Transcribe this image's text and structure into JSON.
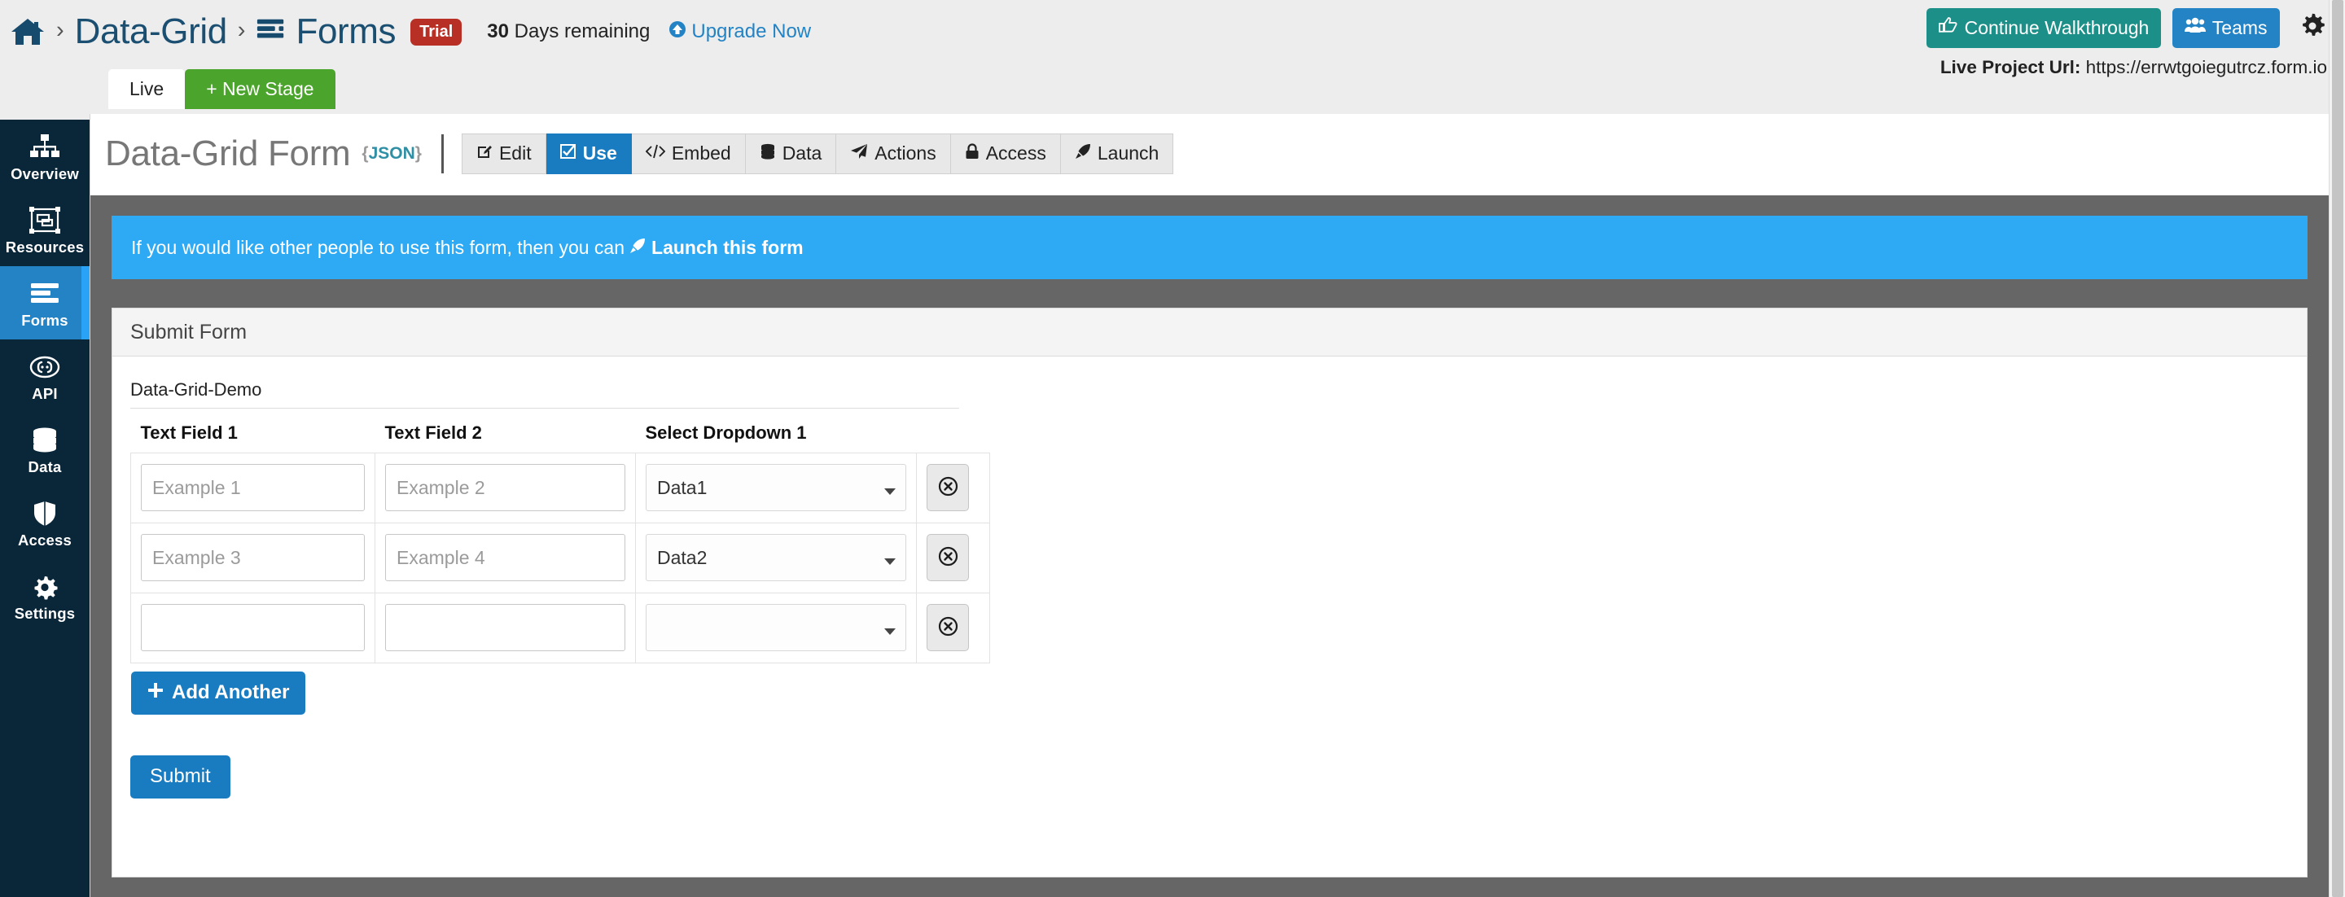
{
  "header": {
    "breadcrumb": {
      "home_icon": "home-icon",
      "separator": "›",
      "project": "Data-Grid",
      "section_icon": "forms-icon",
      "section": "Forms",
      "trial_badge": "Trial"
    },
    "trial_days": "30",
    "trial_text": "Days remaining",
    "upgrade_label": "Upgrade Now",
    "walkthrough_label": "Continue Walkthrough",
    "teams_label": "Teams",
    "gear_icon": "gear-icon",
    "live_url_label": "Live Project Url:",
    "live_url_value": "https://errwtgoiegutrcz.form.io"
  },
  "stage_tabs": [
    {
      "label": "Live",
      "active": true
    },
    {
      "label": "+ New Stage",
      "active": false
    }
  ],
  "sidebar": {
    "items": [
      {
        "label": "Overview",
        "icon": "sitemap-icon",
        "active": false
      },
      {
        "label": "Resources",
        "icon": "resources-icon",
        "active": false
      },
      {
        "label": "Forms",
        "icon": "forms-icon",
        "active": true
      },
      {
        "label": "API",
        "icon": "api-braces-icon",
        "active": false
      },
      {
        "label": "Data",
        "icon": "database-icon",
        "active": false
      },
      {
        "label": "Access",
        "icon": "shield-icon",
        "active": false
      },
      {
        "label": "Settings",
        "icon": "gear-icon",
        "active": false
      }
    ]
  },
  "form": {
    "title": "Data-Grid Form",
    "json_label": "{JSON}",
    "tabs": [
      {
        "label": "Edit",
        "icon": "pencil-square-icon",
        "active": false
      },
      {
        "label": "Use",
        "icon": "check-square-icon",
        "active": true
      },
      {
        "label": "Embed",
        "icon": "code-icon",
        "active": false
      },
      {
        "label": "Data",
        "icon": "database-icon",
        "active": false
      },
      {
        "label": "Actions",
        "icon": "paper-plane-icon",
        "active": false
      },
      {
        "label": "Access",
        "icon": "lock-icon",
        "active": false
      },
      {
        "label": "Launch",
        "icon": "rocket-icon",
        "active": false
      }
    ]
  },
  "alert": {
    "text": "If you would like other people to use this form, then you can",
    "link_label": "Launch this form",
    "link_icon": "rocket-icon",
    "bg_color": "#2eaaf5"
  },
  "panel": {
    "heading": "Submit Form",
    "grid_label": "Data-Grid-Demo",
    "columns": [
      "Text Field 1",
      "Text Field 2",
      "Select Dropdown 1"
    ],
    "rows": [
      {
        "text1_value": "",
        "text1_placeholder": "Example 1",
        "text2_value": "",
        "text2_placeholder": "Example 2",
        "select_value": "Data1",
        "remove_icon": "remove-circle-icon"
      },
      {
        "text1_value": "",
        "text1_placeholder": "Example 3",
        "text2_value": "",
        "text2_placeholder": "Example 4",
        "select_value": "Data2",
        "remove_icon": "remove-circle-icon"
      },
      {
        "text1_value": "",
        "text1_placeholder": "",
        "text2_value": "",
        "text2_placeholder": "",
        "select_value": "",
        "remove_icon": "remove-circle-icon"
      }
    ],
    "select_options": [
      "",
      "Data1",
      "Data2"
    ],
    "add_another_label": "Add Another",
    "submit_label": "Submit"
  },
  "annotations": [
    {
      "name": "arrow-pointing-remove-button",
      "color": "#1a7cc0"
    },
    {
      "name": "arrow-pointing-add-another",
      "color": "#1a7cc0"
    }
  ],
  "colors": {
    "sidebar_bg": "#0a2639",
    "accent_blue": "#2383c4",
    "teal": "#1c9088",
    "green": "#4ba42b",
    "red": "#b82f26",
    "content_bg": "#666666"
  }
}
